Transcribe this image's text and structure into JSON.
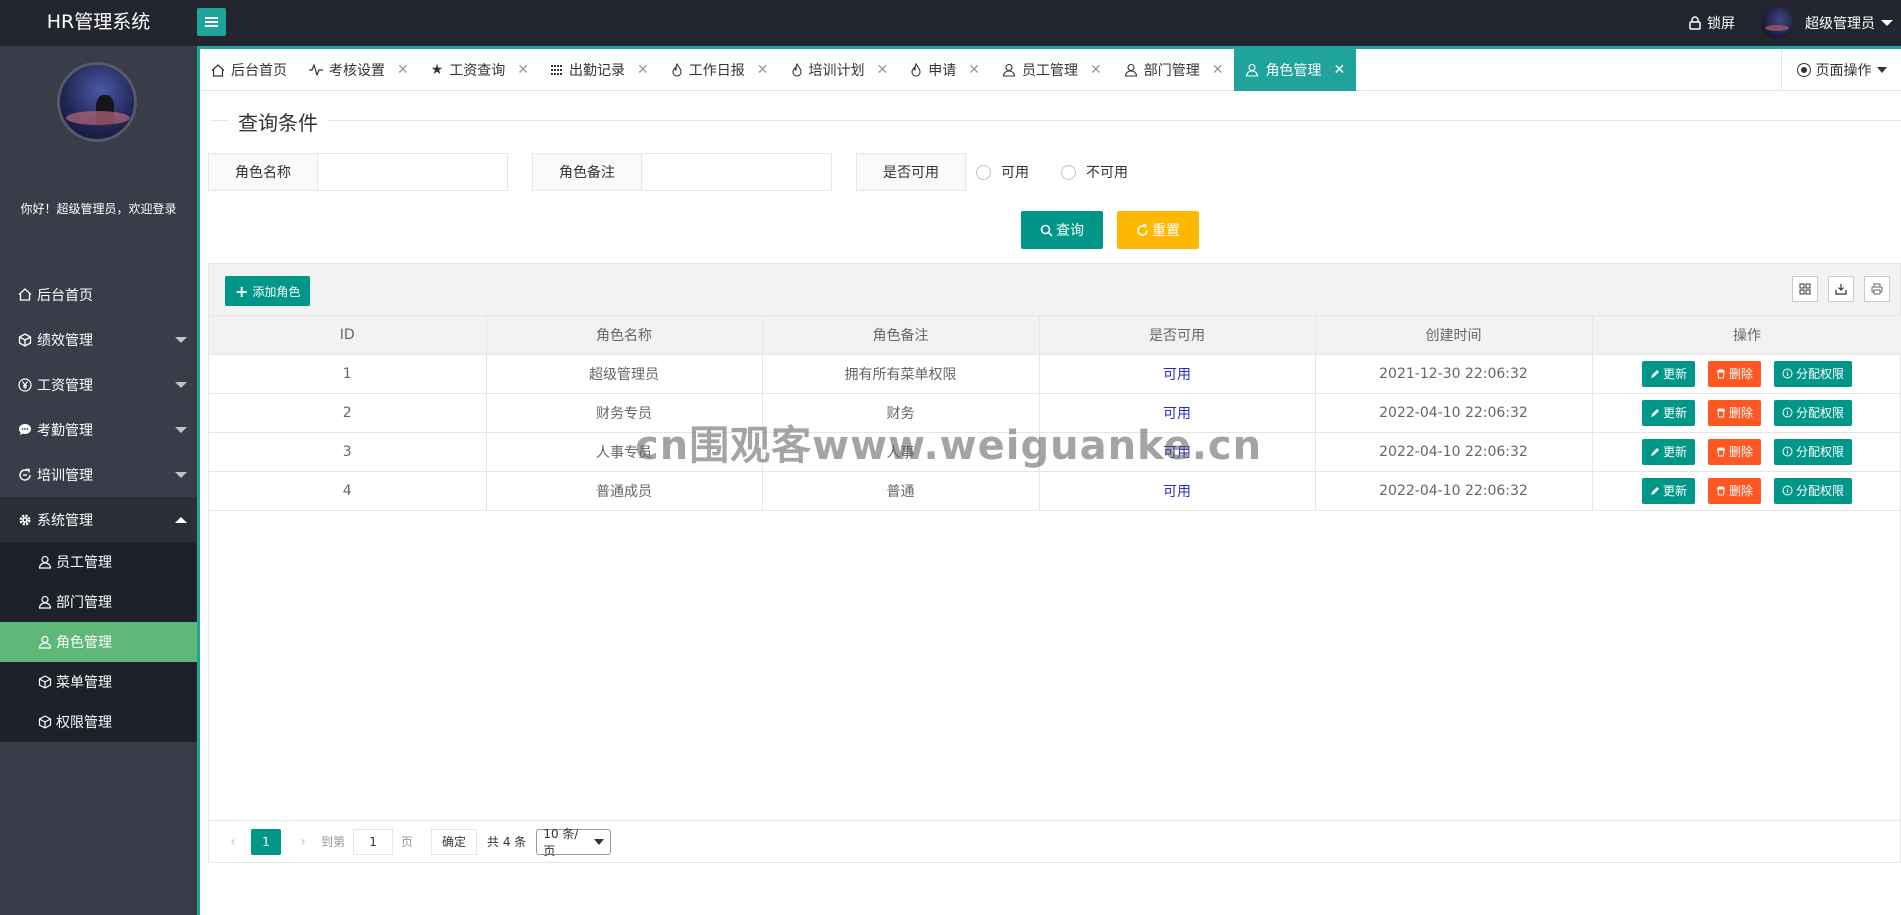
{
  "app": {
    "title": "HR管理系统"
  },
  "header": {
    "lock_label": "锁屏",
    "user_name": "超级管理员"
  },
  "sidebar": {
    "welcome": "你好！超级管理员，欢迎登录",
    "items": [
      {
        "label": "后台首页",
        "icon": "home-icon"
      },
      {
        "label": "绩效管理",
        "icon": "cube-icon"
      },
      {
        "label": "工资管理",
        "icon": "yen-icon"
      },
      {
        "label": "考勤管理",
        "icon": "chat-icon"
      },
      {
        "label": "培训管理",
        "icon": "refresh-icon"
      },
      {
        "label": "系统管理",
        "icon": "gear-icon"
      }
    ],
    "sub_items": [
      {
        "label": "员工管理",
        "icon": "user-icon"
      },
      {
        "label": "部门管理",
        "icon": "user-icon"
      },
      {
        "label": "角色管理",
        "icon": "user-icon"
      },
      {
        "label": "菜单管理",
        "icon": "cube-icon"
      },
      {
        "label": "权限管理",
        "icon": "cube-icon"
      }
    ]
  },
  "tabs": [
    {
      "label": "后台首页",
      "icon": "home-icon"
    },
    {
      "label": "考核设置",
      "icon": "pulse-icon"
    },
    {
      "label": "工资查询",
      "icon": "star-icon"
    },
    {
      "label": "出勤记录",
      "icon": "grid-icon"
    },
    {
      "label": "工作日报",
      "icon": "fire-icon"
    },
    {
      "label": "培训计划",
      "icon": "fire-icon"
    },
    {
      "label": "申请",
      "icon": "fire-icon"
    },
    {
      "label": "员工管理",
      "icon": "user-icon"
    },
    {
      "label": "部门管理",
      "icon": "user-icon"
    },
    {
      "label": "角色管理",
      "icon": "user-icon"
    }
  ],
  "page_ops": "页面操作",
  "query": {
    "legend": "查询条件",
    "role_name_label": "角色名称",
    "role_note_label": "角色备注",
    "enabled_label": "是否可用",
    "opt_yes": "可用",
    "opt_no": "不可用",
    "search_btn": "查询",
    "reset_btn": "重置"
  },
  "toolbar": {
    "add_btn": "添加角色"
  },
  "table": {
    "columns": [
      "ID",
      "角色名称",
      "角色备注",
      "是否可用",
      "创建时间",
      "操作"
    ],
    "rows": [
      {
        "id": "1",
        "name": "超级管理员",
        "note": "拥有所有菜单权限",
        "status": "可用",
        "created": "2021-12-30 22:06:32"
      },
      {
        "id": "2",
        "name": "财务专员",
        "note": "财务",
        "status": "可用",
        "created": "2022-04-10 22:06:32"
      },
      {
        "id": "3",
        "name": "人事专员",
        "note": "人事",
        "status": "可用",
        "created": "2022-04-10 22:06:32"
      },
      {
        "id": "4",
        "name": "普通成员",
        "note": "普通",
        "status": "可用",
        "created": "2022-04-10 22:06:32"
      }
    ],
    "op_update": "更新",
    "op_delete": "删除",
    "op_assign": "分配权限"
  },
  "pager": {
    "current": "1",
    "goto_label": "到第",
    "goto_value": "1",
    "page_label": "页",
    "confirm": "确定",
    "total": "共 4 条",
    "per_page": "10 条/页"
  },
  "watermark": "cn围观客www.weiguanke.cn",
  "colors": {
    "accent": "#009688",
    "danger": "#ff5722",
    "warn": "#ffb800",
    "active_sub": "#5fb878",
    "sidebar": "#393d49",
    "topbar": "#23262e"
  }
}
